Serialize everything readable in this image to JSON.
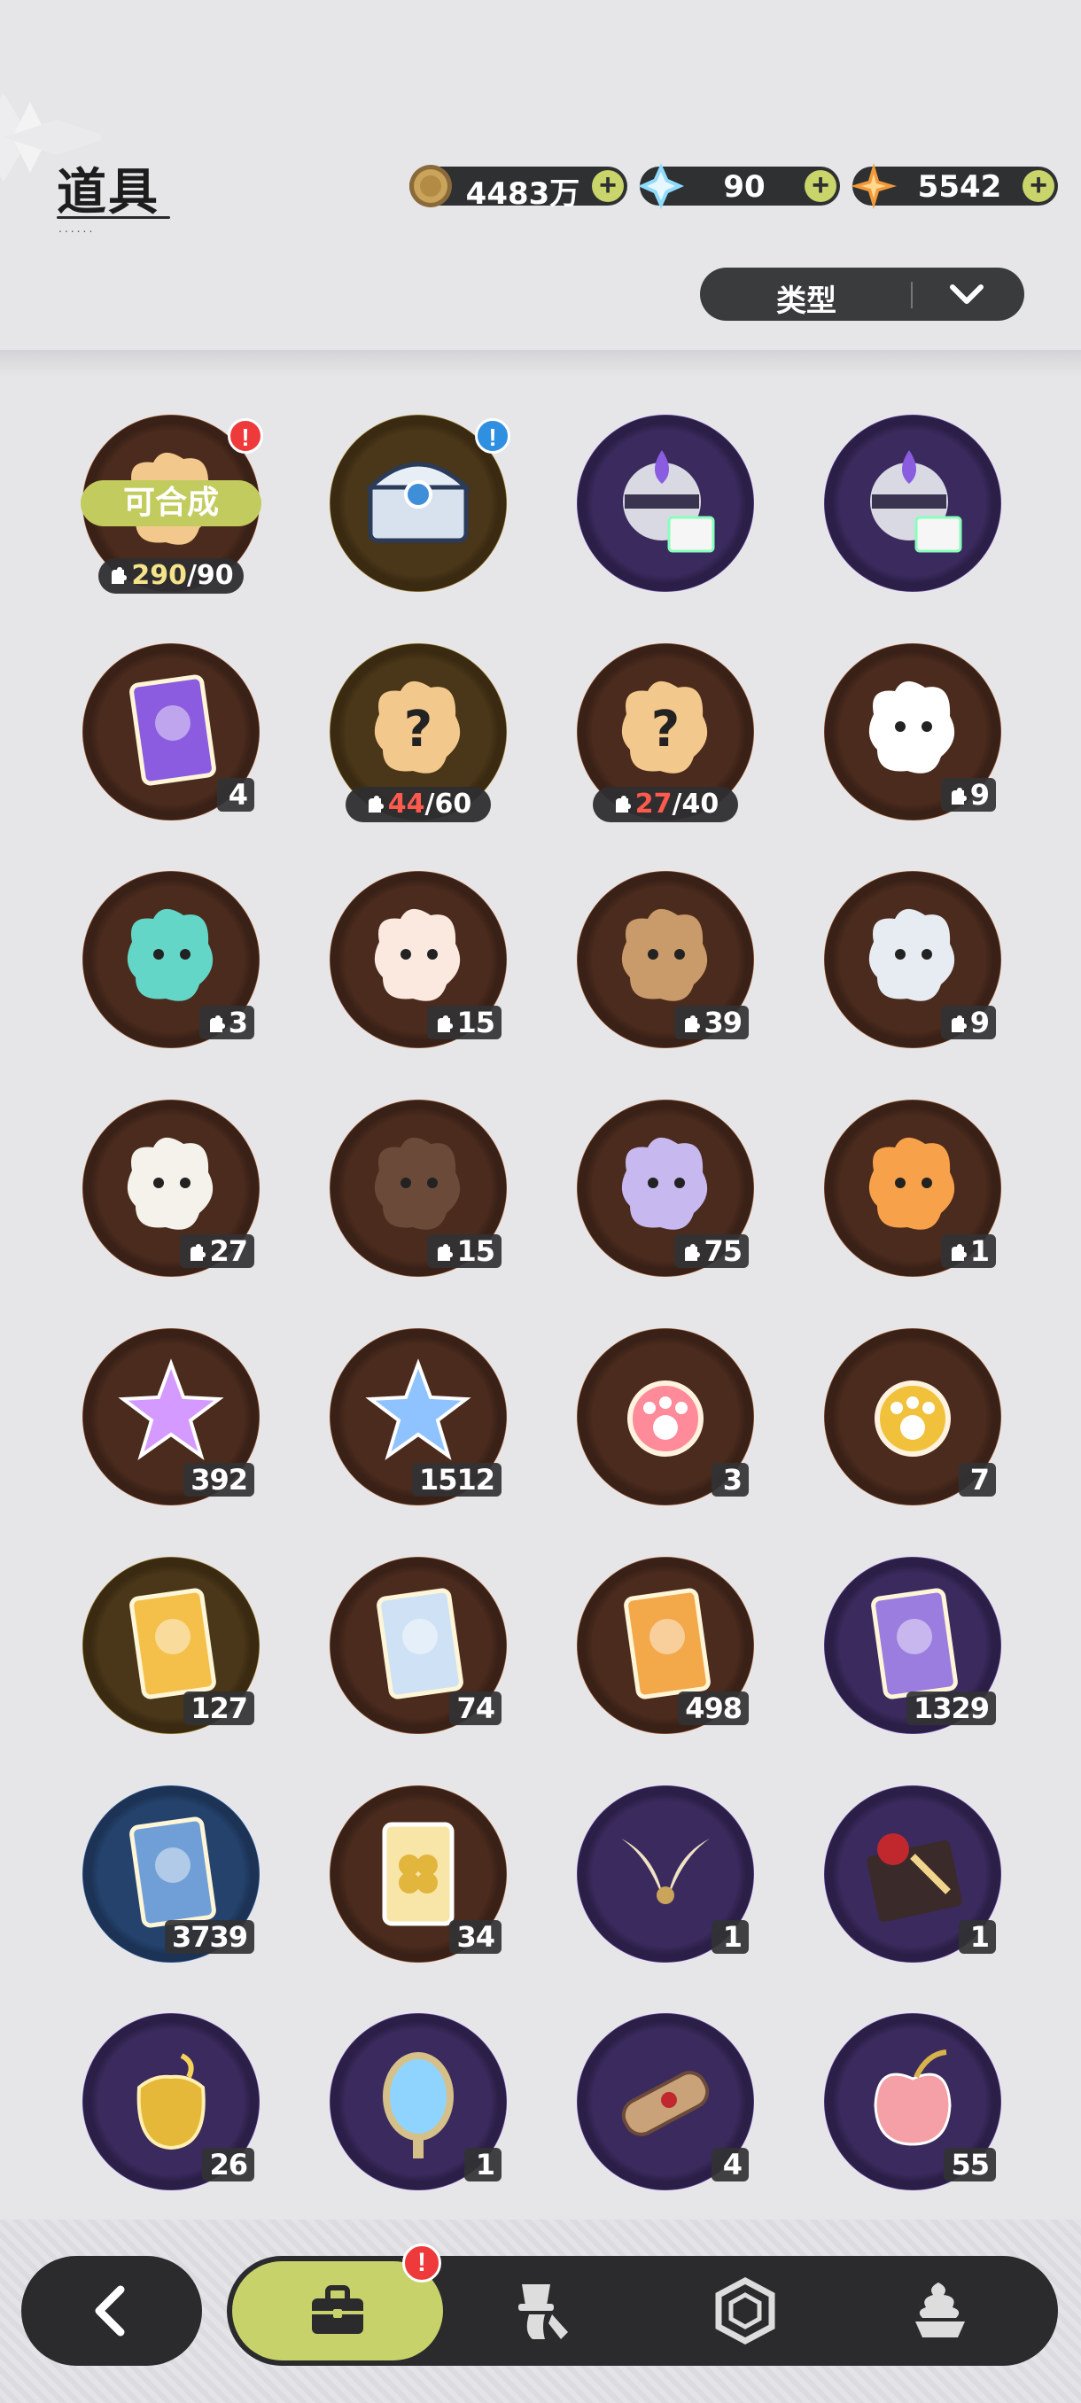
{
  "header": {
    "title": "道具"
  },
  "currencies": [
    {
      "name": "gold-coin",
      "value": "4483万",
      "color": "#c9a45a"
    },
    {
      "name": "crystal",
      "value": "90",
      "color": "#7fd0ff"
    },
    {
      "name": "star-shard",
      "value": "5542",
      "color": "#f2a447"
    }
  ],
  "filter": {
    "label": "类型"
  },
  "items": [
    {
      "ring": "orange",
      "icon": "piece-mystery-icon",
      "craft_label": "可合成",
      "frac_cur": "290",
      "frac_max": "/90",
      "frac_color": "yellow",
      "badge": "!",
      "badge_color": "red"
    },
    {
      "ring": "gold",
      "icon": "treasure-chest-icon",
      "badge": "!",
      "badge_color": "blue"
    },
    {
      "ring": "purple",
      "icon": "gift-orb-icon"
    },
    {
      "ring": "purple",
      "icon": "gift-orb-icon"
    },
    {
      "ring": "orange",
      "icon": "purple-crystal-card-icon",
      "count": "4"
    },
    {
      "ring": "gold",
      "icon": "mystery-piece-gold-icon",
      "frac_cur": "44",
      "frac_max": "/60",
      "frac_color": "red"
    },
    {
      "ring": "orange",
      "icon": "mystery-piece-icon",
      "frac_cur": "27",
      "frac_max": "/40",
      "frac_color": "red"
    },
    {
      "ring": "orange",
      "icon": "white-creature-piece-icon",
      "count": "9",
      "piece": true
    },
    {
      "ring": "orange",
      "icon": "teal-bird-piece-icon",
      "count": "3",
      "piece": true
    },
    {
      "ring": "orange",
      "icon": "fox-mask-piece-icon",
      "count": "15",
      "piece": true
    },
    {
      "ring": "orange",
      "icon": "bear-piece-icon",
      "count": "39",
      "piece": true
    },
    {
      "ring": "orange",
      "icon": "knight-cat-piece-icon",
      "count": "9",
      "piece": true
    },
    {
      "ring": "orange",
      "icon": "moth-piece-icon",
      "count": "27",
      "piece": true
    },
    {
      "ring": "orange",
      "icon": "dark-bear-piece-icon",
      "count": "15",
      "piece": true
    },
    {
      "ring": "orange",
      "icon": "purple-cat-piece-icon",
      "count": "75",
      "piece": true
    },
    {
      "ring": "orange",
      "icon": "tiger-piece-icon",
      "count": "1",
      "piece": true
    },
    {
      "ring": "orange",
      "icon": "pink-star-crystal-icon",
      "count": "392"
    },
    {
      "ring": "orange",
      "icon": "blue-star-crystal-icon",
      "count": "1512"
    },
    {
      "ring": "orange",
      "icon": "paw-charm-red-icon",
      "count": "3"
    },
    {
      "ring": "orange",
      "icon": "paw-charm-gold-icon",
      "count": "7"
    },
    {
      "ring": "gold",
      "icon": "gold-card-icon",
      "count": "127"
    },
    {
      "ring": "orange",
      "icon": "holo-card-icon",
      "count": "74"
    },
    {
      "ring": "orange",
      "icon": "orange-card-icon",
      "count": "498"
    },
    {
      "ring": "purple",
      "icon": "purple-card-icon",
      "count": "1329"
    },
    {
      "ring": "blue",
      "icon": "blue-card-icon",
      "count": "3739"
    },
    {
      "ring": "orange",
      "icon": "clover-ticket-icon",
      "count": "34"
    },
    {
      "ring": "purple",
      "icon": "horn-ornament-icon",
      "count": "1"
    },
    {
      "ring": "purple",
      "icon": "rose-giftbox-icon",
      "count": "1"
    },
    {
      "ring": "purple",
      "icon": "gold-pouch-icon",
      "count": "26"
    },
    {
      "ring": "purple",
      "icon": "magic-mirror-icon",
      "count": "1"
    },
    {
      "ring": "purple",
      "icon": "scroll-icon",
      "count": "4"
    },
    {
      "ring": "purple",
      "icon": "pink-apple-icon",
      "count": "55"
    }
  ],
  "bottom_nav": {
    "back_icon": "back-arrow-icon",
    "tabs": [
      {
        "icon": "bag-icon",
        "active": true,
        "badge": "!"
      },
      {
        "icon": "outfit-icon"
      },
      {
        "icon": "gem-icon"
      },
      {
        "icon": "dessert-icon"
      }
    ]
  }
}
